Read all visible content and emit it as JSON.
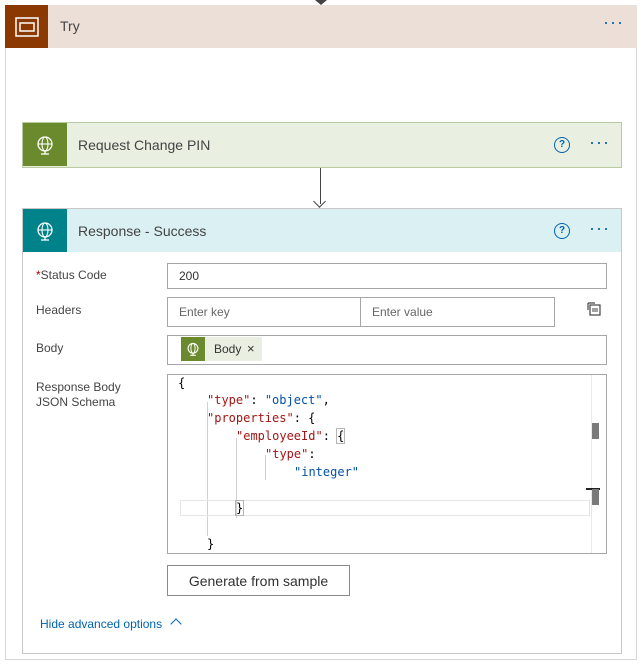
{
  "scope": {
    "title": "Try",
    "more_label": "···"
  },
  "action1": {
    "title": "Request Change PIN",
    "help_label": "?",
    "more_label": "···"
  },
  "action2": {
    "title": "Response - Success",
    "help_label": "?",
    "more_label": "···",
    "fields": {
      "status_code": {
        "label": "Status Code",
        "required_mark": "*",
        "value": "200"
      },
      "headers": {
        "label": "Headers",
        "key_placeholder": "Enter key",
        "value_placeholder": "Enter value"
      },
      "body": {
        "label": "Body",
        "token_label": "Body",
        "token_remove": "×"
      },
      "schema": {
        "label": "Response Body JSON Schema"
      }
    },
    "schema_code": {
      "l1": "{",
      "l2_key": "\"type\"",
      "l2_sep": ": ",
      "l2_val": "\"object\"",
      "l2_end": ",",
      "l3_key": "\"properties\"",
      "l3_sep": ": {",
      "l4_key": "\"employeeId\"",
      "l4_sep": ": ",
      "l4_brace": "{",
      "l5_key": "\"type\"",
      "l5_sep": ":",
      "l6_val": "\"integer\"",
      "l7": "}",
      "l8": "}"
    },
    "generate_button": "Generate from sample",
    "hide_advanced": "Hide advanced options"
  },
  "colors": {
    "scope_accent": "#8c3900",
    "scope_header_bg": "#ecdfd8",
    "action1_accent": "#6a8a2d",
    "action1_header_bg": "#e9efe1",
    "action2_accent": "#00828b",
    "action2_header_bg": "#daf0f2",
    "link": "#0063b1"
  },
  "icons": {
    "scope": "scope-icon",
    "action1": "globe-gear-icon",
    "action2": "globe-gear-icon",
    "headers_mode": "switch-mode-icon",
    "collapse": "chevron-up-icon"
  }
}
